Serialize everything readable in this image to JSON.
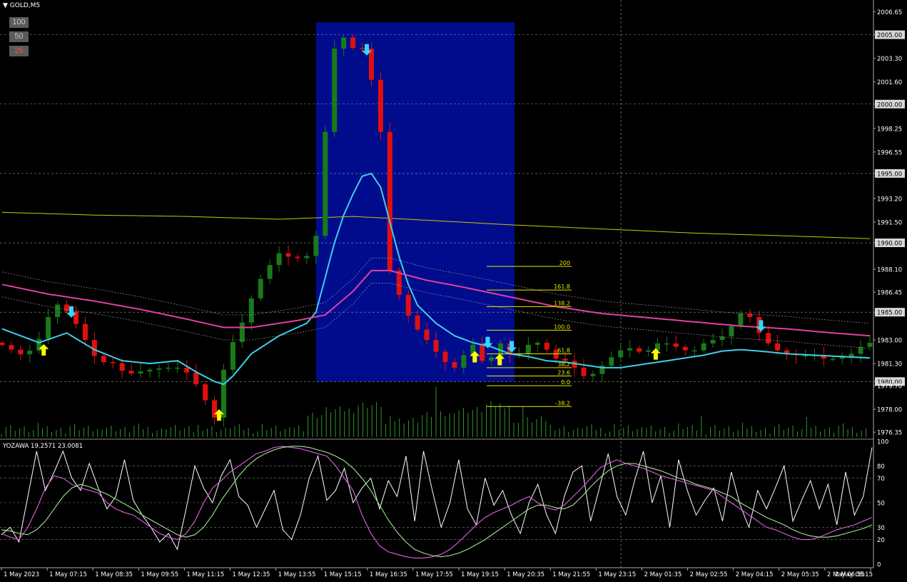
{
  "symbol": {
    "label": "GOLD,M5"
  },
  "zoom_buttons": [
    {
      "label": "100",
      "active": false
    },
    {
      "label": "50",
      "active": false
    },
    {
      "label": "25",
      "active": true
    }
  ],
  "indicator": {
    "label": "YOZAWA 19.2571 23.0081",
    "levels": [
      100,
      80,
      70,
      50,
      30,
      20,
      0
    ]
  },
  "colors": {
    "bull": "#1a7a1a",
    "bear": "#e01010",
    "ma_fast": "#3ecfe8",
    "ma_slow": "#e040a0",
    "band": "#c8c800",
    "fib": "#e8e800",
    "zone": "#000c8c",
    "arrow_up": "#ffff00",
    "arrow_down": "#30d8ff",
    "grid": "#d0d0d0",
    "stoch_k": "#ffffff",
    "stoch_d": "#a0e890",
    "stoch_s": "#e060e0"
  },
  "chart_data": [
    {
      "type": "candlestick",
      "title": "GOLD,M5",
      "ylim": [
        1976.0,
        2007.4
      ],
      "grid": true,
      "y_ticks": [
        "2006.65",
        "2005.00",
        "2003.30",
        "2001.60",
        "2000.00",
        "1998.25",
        "1996.55",
        "1995.00",
        "1993.20",
        "1991.50",
        "1990.00",
        "1988.10",
        "1986.45",
        "1985.00",
        "1983.00",
        "1981.30",
        "1980.00",
        "1979.70",
        "1978.00",
        "1976.35"
      ],
      "highlighted_levels": [
        "2005.00",
        "2000.00",
        "1995.00",
        "1990.00",
        "1985.00",
        "1980.00"
      ],
      "x_ticks": [
        "1 May 2023",
        "1 May 07:15",
        "1 May 08:35",
        "1 May 09:55",
        "1 May 11:15",
        "1 May 12:35",
        "1 May 13:55",
        "1 May 15:15",
        "1 May 16:35",
        "1 May 17:55",
        "1 May 19:15",
        "1 May 20:35",
        "1 May 21:55",
        "1 May 23:15",
        "2 May 01:35",
        "2 May 02:55",
        "2 May 04:15",
        "2 May 05:35",
        "2 May 06:55",
        "2 May 08:15"
      ],
      "close_path": [
        [
          0,
          1982.8
        ],
        [
          3,
          1981.8
        ],
        [
          5,
          1983.5
        ],
        [
          6,
          1985.8
        ],
        [
          8,
          1984.8
        ],
        [
          9,
          1983.5
        ],
        [
          10,
          1982.5
        ],
        [
          11,
          1981.2
        ],
        [
          12,
          1981.6
        ],
        [
          14,
          1980.5
        ],
        [
          16,
          1980.8
        ],
        [
          18,
          1981.0
        ],
        [
          20,
          1981.0
        ],
        [
          21,
          1980.3
        ],
        [
          22,
          1979.3
        ],
        [
          23,
          1978.0
        ],
        [
          23.5,
          1977.4
        ],
        [
          24,
          1979.5
        ],
        [
          25,
          1982.2
        ],
        [
          26,
          1983.5
        ],
        [
          27,
          1985.0
        ],
        [
          28,
          1987.0
        ],
        [
          29,
          1987.8
        ],
        [
          30,
          1989.0
        ],
        [
          31,
          1989.5
        ],
        [
          32,
          1988.5
        ],
        [
          33,
          1989.3
        ],
        [
          34,
          1988.8
        ],
        [
          34.5,
          1990.5
        ],
        [
          35,
          1993.0
        ],
        [
          35.5,
          1998.0
        ],
        [
          36,
          2001.0
        ],
        [
          36.5,
          2004.0
        ],
        [
          37,
          2005.0
        ],
        [
          38,
          2004.6
        ],
        [
          39,
          2003.5
        ],
        [
          39.5,
          2004.0
        ],
        [
          40,
          2002.5
        ],
        [
          41,
          2001.0
        ],
        [
          41.5,
          1998.0
        ],
        [
          42,
          1993.0
        ],
        [
          42.5,
          1988.0
        ],
        [
          43,
          1987.0
        ],
        [
          44,
          1985.5
        ],
        [
          45,
          1984.0
        ],
        [
          46,
          1983.5
        ],
        [
          47,
          1982.5
        ],
        [
          48,
          1981.8
        ],
        [
          49,
          1981.0
        ],
        [
          50,
          1981.0
        ],
        [
          51,
          1982.8
        ],
        [
          52,
          1982.5
        ],
        [
          53,
          1980.5
        ],
        [
          54,
          1983.0
        ],
        [
          55,
          1982.5
        ],
        [
          56,
          1981.5
        ],
        [
          57,
          1982.5
        ],
        [
          58,
          1982.8
        ],
        [
          59,
          1982.8
        ],
        [
          60,
          1981.8
        ],
        [
          61,
          1981.5
        ],
        [
          62,
          1981.5
        ],
        [
          63,
          1980.5
        ],
        [
          64,
          1980.3
        ],
        [
          65,
          1980.8
        ],
        [
          66,
          1981.5
        ],
        [
          67,
          1982.0
        ],
        [
          68,
          1982.5
        ],
        [
          69,
          1982.3
        ],
        [
          70,
          1982.0
        ],
        [
          71,
          1982.5
        ],
        [
          72,
          1983.0
        ],
        [
          73,
          1982.5
        ],
        [
          74,
          1982.5
        ],
        [
          75,
          1982.0
        ],
        [
          76,
          1982.5
        ],
        [
          77,
          1983.0
        ],
        [
          78,
          1983.0
        ],
        [
          79,
          1983.5
        ],
        [
          80,
          1984.5
        ],
        [
          81,
          1985.3
        ],
        [
          82,
          1984.0
        ],
        [
          83,
          1983.0
        ],
        [
          84,
          1982.5
        ],
        [
          85,
          1982.0
        ],
        [
          86,
          1982.0
        ],
        [
          87,
          1981.8
        ],
        [
          88,
          1982.0
        ],
        [
          89,
          1981.8
        ],
        [
          90,
          1981.5
        ],
        [
          91,
          1981.8
        ],
        [
          92,
          1981.8
        ],
        [
          93,
          1982.2
        ],
        [
          94,
          1982.8
        ]
      ],
      "series": [
        {
          "role": "moving_average_fast",
          "points": [
            [
              0,
              1983.8
            ],
            [
              4,
              1982.8
            ],
            [
              7,
              1983.5
            ],
            [
              10,
              1982.3
            ],
            [
              13,
              1981.5
            ],
            [
              16,
              1981.3
            ],
            [
              19,
              1981.5
            ],
            [
              21,
              1980.7
            ],
            [
              23,
              1980.0
            ],
            [
              24,
              1979.8
            ],
            [
              25,
              1980.4
            ],
            [
              27,
              1982.0
            ],
            [
              30,
              1983.3
            ],
            [
              33,
              1984.2
            ],
            [
              34,
              1985.0
            ],
            [
              35,
              1987.5
            ],
            [
              36,
              1990.0
            ],
            [
              37,
              1992.0
            ],
            [
              38,
              1993.5
            ],
            [
              39,
              1994.8
            ],
            [
              40,
              1995.0
            ],
            [
              41,
              1994.0
            ],
            [
              42,
              1991.5
            ],
            [
              43,
              1989.0
            ],
            [
              44,
              1987.0
            ],
            [
              45,
              1985.5
            ],
            [
              47,
              1984.2
            ],
            [
              49,
              1983.3
            ],
            [
              51,
              1982.8
            ],
            [
              53,
              1982.5
            ],
            [
              55,
              1982.0
            ],
            [
              57,
              1981.8
            ],
            [
              59,
              1981.5
            ],
            [
              61,
              1981.4
            ],
            [
              63,
              1981.2
            ],
            [
              65,
              1981.0
            ],
            [
              67,
              1981.0
            ],
            [
              70,
              1981.3
            ],
            [
              73,
              1981.6
            ],
            [
              76,
              1981.9
            ],
            [
              78,
              1982.2
            ],
            [
              80,
              1982.3
            ],
            [
              82,
              1982.2
            ],
            [
              85,
              1982.0
            ],
            [
              88,
              1981.9
            ],
            [
              91,
              1981.8
            ],
            [
              94,
              1981.7
            ]
          ]
        },
        {
          "role": "moving_average_slow",
          "points": [
            [
              0,
              1987.0
            ],
            [
              5,
              1986.3
            ],
            [
              10,
              1985.8
            ],
            [
              15,
              1985.2
            ],
            [
              20,
              1984.5
            ],
            [
              24,
              1983.9
            ],
            [
              27,
              1983.9
            ],
            [
              32,
              1984.4
            ],
            [
              35,
              1984.8
            ],
            [
              38,
              1986.5
            ],
            [
              40,
              1988.0
            ],
            [
              42,
              1988.0
            ],
            [
              46,
              1987.3
            ],
            [
              50,
              1986.8
            ],
            [
              55,
              1986.1
            ],
            [
              60,
              1985.4
            ],
            [
              65,
              1984.9
            ],
            [
              70,
              1984.6
            ],
            [
              75,
              1984.3
            ],
            [
              80,
              1984.0
            ],
            [
              85,
              1983.8
            ],
            [
              90,
              1983.5
            ],
            [
              94,
              1983.3
            ]
          ]
        },
        {
          "role": "upper_band",
          "points": [
            [
              0,
              1992.2
            ],
            [
              10,
              1992.0
            ],
            [
              20,
              1991.9
            ],
            [
              30,
              1991.7
            ],
            [
              38,
              1991.9
            ],
            [
              44,
              1991.7
            ],
            [
              55,
              1991.3
            ],
            [
              65,
              1991.0
            ],
            [
              75,
              1990.7
            ],
            [
              85,
              1990.5
            ],
            [
              94,
              1990.3
            ]
          ]
        }
      ],
      "zone": {
        "x_start": 34,
        "x_end": 55.5,
        "y_top": 2005.9,
        "y_bottom": 1980.0
      },
      "fibonacci": [
        {
          "label": "200",
          "price": 1988.3
        },
        {
          "label": "161.8",
          "price": 1986.6
        },
        {
          "label": "138.2",
          "price": 1985.4
        },
        {
          "label": "100.0",
          "price": 1983.7
        },
        {
          "label": "61.8",
          "price": 1982.0
        },
        {
          "label": "38.2",
          "price": 1981.0
        },
        {
          "label": "23.6",
          "price": 1980.4
        },
        {
          "label": "0.0",
          "price": 1979.7
        },
        {
          "label": "-38.2",
          "price": 1978.2
        }
      ],
      "arrows": [
        {
          "x": 4.5,
          "price": 1982.7,
          "dir": "up"
        },
        {
          "x": 7.5,
          "price": 1984.6,
          "dir": "down"
        },
        {
          "x": 23.5,
          "price": 1978.0,
          "dir": "up"
        },
        {
          "x": 39.5,
          "price": 2003.5,
          "dir": "down"
        },
        {
          "x": 51.2,
          "price": 1982.2,
          "dir": "up"
        },
        {
          "x": 52.6,
          "price": 1982.4,
          "dir": "down"
        },
        {
          "x": 53.9,
          "price": 1982.0,
          "dir": "up"
        },
        {
          "x": 55.2,
          "price": 1982.1,
          "dir": "down"
        },
        {
          "x": 70.8,
          "price": 1982.4,
          "dir": "up"
        },
        {
          "x": 82.2,
          "price": 1983.6,
          "dir": "down"
        }
      ]
    },
    {
      "type": "line",
      "title": "YOZAWA 19.2571 23.0081",
      "ylim": [
        0,
        100
      ],
      "y_ticks": [
        "100",
        "80",
        "70",
        "50",
        "30",
        "20",
        "0"
      ],
      "series": [
        {
          "role": "fast",
          "values": [
            24,
            30,
            18,
            55,
            92,
            60,
            75,
            92,
            70,
            60,
            82,
            62,
            45,
            55,
            85,
            52,
            40,
            30,
            18,
            25,
            12,
            45,
            80,
            62,
            50,
            72,
            85,
            55,
            48,
            30,
            45,
            60,
            28,
            20,
            40,
            70,
            88,
            52,
            60,
            78,
            50,
            62,
            70,
            45,
            68,
            55,
            88,
            35,
            92,
            60,
            30,
            50,
            85,
            45,
            32,
            70,
            48,
            60,
            40,
            25,
            50,
            65,
            40,
            25,
            55,
            75,
            80,
            35,
            62,
            90,
            55,
            40,
            68,
            92,
            50,
            72,
            30,
            85,
            60,
            40,
            52,
            62,
            35,
            75,
            48,
            30,
            60,
            45,
            62,
            80,
            35,
            52,
            68,
            45,
            65,
            32,
            75,
            40,
            55,
            95
          ]
        },
        {
          "role": "slow",
          "values": [
            25,
            22,
            20,
            30,
            45,
            62,
            72,
            70,
            65,
            62,
            60,
            58,
            50,
            45,
            42,
            40,
            35,
            30,
            25,
            22,
            20,
            25,
            35,
            50,
            62,
            68,
            75,
            80,
            85,
            90,
            92,
            95,
            96,
            95,
            94,
            92,
            90,
            88,
            80,
            70,
            60,
            40,
            25,
            15,
            10,
            8,
            6,
            5,
            5,
            6,
            8,
            12,
            18,
            25,
            32,
            38,
            42,
            45,
            48,
            52,
            55,
            50,
            46,
            44,
            48,
            55,
            62,
            70,
            78,
            82,
            85,
            82,
            80,
            78,
            75,
            72,
            70,
            68,
            66,
            64,
            62,
            60,
            55,
            50,
            45,
            40,
            35,
            30,
            28,
            25,
            22,
            20,
            20,
            22,
            25,
            28,
            30,
            32,
            35,
            38
          ]
        },
        {
          "role": "signal",
          "values": [
            28,
            27,
            25,
            24,
            28,
            35,
            45,
            55,
            62,
            65,
            63,
            60,
            57,
            53,
            49,
            45,
            40,
            36,
            32,
            28,
            24,
            22,
            24,
            30,
            40,
            52,
            62,
            72,
            80,
            86,
            90,
            93,
            95,
            96,
            96,
            95,
            93,
            91,
            88,
            84,
            78,
            70,
            60,
            48,
            36,
            26,
            18,
            12,
            9,
            7,
            6,
            7,
            9,
            12,
            16,
            20,
            25,
            30,
            35,
            40,
            45,
            48,
            48,
            46,
            45,
            48,
            55,
            63,
            70,
            76,
            80,
            82,
            82,
            80,
            78,
            76,
            73,
            70,
            68,
            65,
            63,
            61,
            58,
            55,
            50,
            46,
            42,
            38,
            35,
            32,
            28,
            25,
            23,
            22,
            22,
            23,
            25,
            27,
            29,
            32
          ]
        }
      ]
    }
  ]
}
